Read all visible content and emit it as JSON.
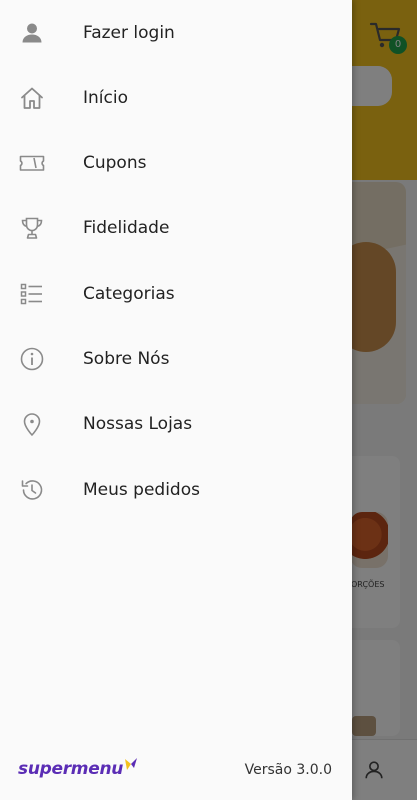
{
  "colors": {
    "accent_yellow": "#f4c21f",
    "brand_purple": "#5b2db5",
    "badge_green": "#21a24a",
    "icon_gray": "#8a8a8a"
  },
  "header": {
    "cart_icon": "cart-icon",
    "cart_count": "0"
  },
  "background": {
    "card_label": "ORÇÕES"
  },
  "drawer": {
    "items": [
      {
        "label": "Fazer login",
        "icon": "user-icon"
      },
      {
        "label": "Início",
        "icon": "home-icon"
      },
      {
        "label": "Cupons",
        "icon": "ticket-icon"
      },
      {
        "label": "Fidelidade",
        "icon": "trophy-icon"
      },
      {
        "label": "Categorias",
        "icon": "list-icon"
      },
      {
        "label": "Sobre Nós",
        "icon": "info-icon"
      },
      {
        "label": "Nossas Lojas",
        "icon": "map-pin-icon"
      },
      {
        "label": "Meus pedidos",
        "icon": "history-icon"
      }
    ],
    "footer": {
      "logo_text": "supermenu",
      "version": "Versão 3.0.0"
    }
  },
  "bottom_nav": {
    "icon": "user-icon"
  }
}
